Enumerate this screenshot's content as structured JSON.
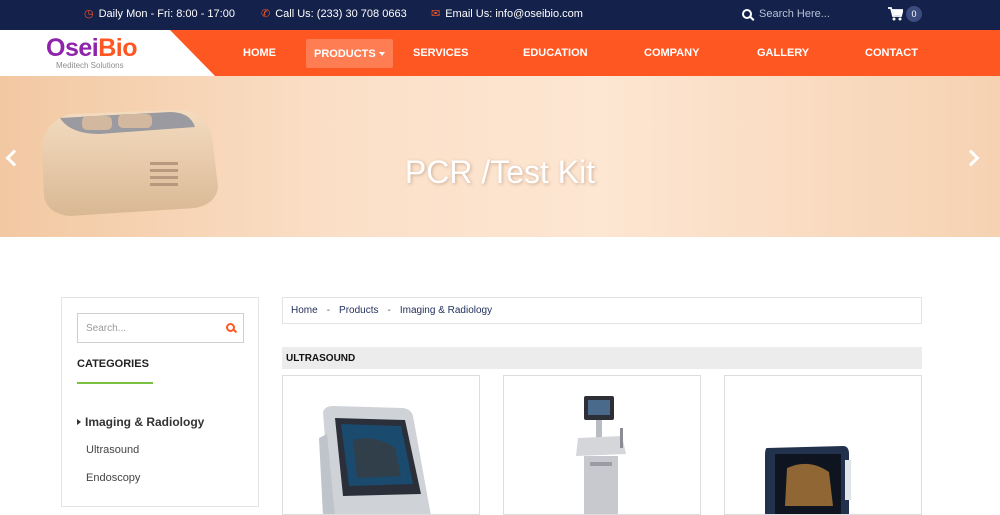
{
  "topbar": {
    "hours": "Daily Mon - Fri: 8:00 - 17:00",
    "phone": "Call Us: (233) 30 708 0663",
    "email": "Email Us: info@oseibio.com",
    "search_placeholder": "Search Here...",
    "cart_count": "0",
    "icons": [
      "clock-icon",
      "phone-icon",
      "envelope-icon",
      "search-icon",
      "cart-icon"
    ]
  },
  "brand": {
    "name_part1": "Osei",
    "name_part2": "Bio",
    "tagline": "Meditech Solutions",
    "colors": {
      "purple": "#8e24aa",
      "orange": "#ff5722",
      "navy": "#14214a",
      "green": "#7cc242"
    }
  },
  "nav": {
    "items": [
      "HOME",
      "PRODUCTS",
      "SERVICES",
      "EDUCATION",
      "COMPANY",
      "GALLERY",
      "CONTACT"
    ],
    "active": "PRODUCTS"
  },
  "hero": {
    "title": "PCR /Test Kit"
  },
  "sidebar": {
    "search_placeholder": "Search...",
    "categories_title": "CATEGORIES",
    "active_category": "Imaging & Radiology",
    "sub_items": [
      "Ultrasound",
      "Endoscopy"
    ]
  },
  "breadcrumb": {
    "items": [
      "Home",
      "Products",
      "Imaging & Radiology"
    ],
    "separator": "-"
  },
  "section": {
    "title": "ULTRASOUND"
  }
}
